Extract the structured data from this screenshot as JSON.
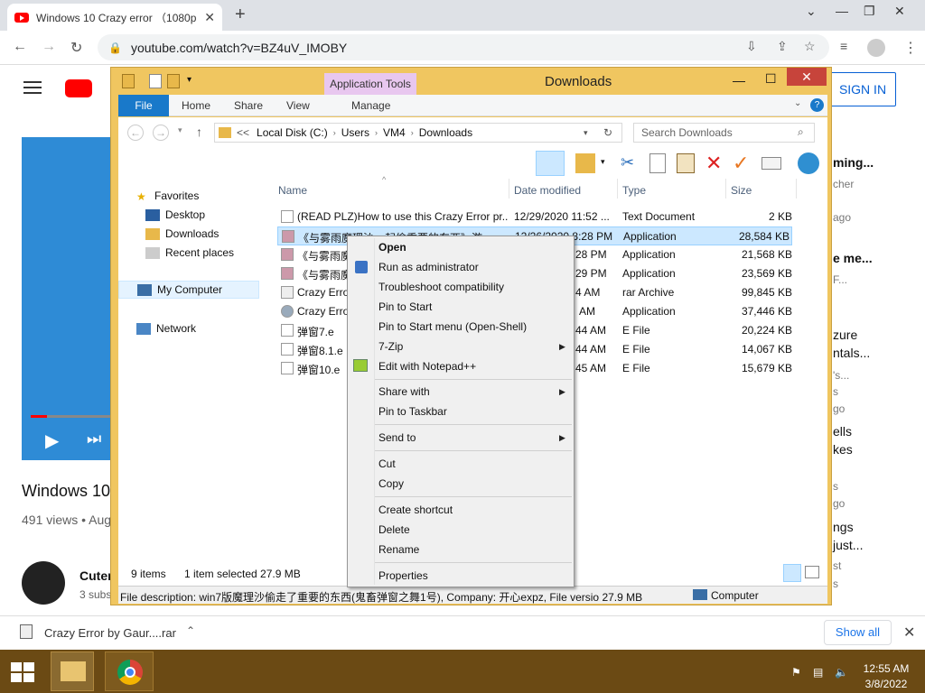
{
  "browser": {
    "tab_title": "Windows 10 Crazy error （1080p",
    "url": "youtube.com/watch?v=BZ4uV_IMOBY"
  },
  "youtube": {
    "video_title": "Windows 10",
    "views": "491 views • Aug",
    "channel": "Cuter",
    "subs": "3 subs",
    "sign_in": "SIGN IN",
    "side": [
      "ming...",
      "cher",
      "ago",
      "e me...",
      "F...",
      "zure",
      "ntals...",
      "'s...",
      "s",
      "go",
      "ells",
      "kes",
      "s",
      "go",
      "ngs",
      "just...",
      "st",
      "s"
    ]
  },
  "explorer": {
    "title": "Downloads",
    "app_tools": "Application Tools",
    "ribbon_tabs": [
      "File",
      "Home",
      "Share",
      "View",
      "Manage"
    ],
    "path": [
      "<<",
      "Local Disk (C:)",
      "Users",
      "VM4",
      "Downloads"
    ],
    "search_placeholder": "Search Downloads",
    "nav": {
      "favorites": "Favorites",
      "desktop": "Desktop",
      "downloads": "Downloads",
      "recent": "Recent places",
      "computer": "My Computer",
      "network": "Network"
    },
    "columns": {
      "name": "Name",
      "date": "Date modified",
      "type": "Type",
      "size": "Size"
    },
    "files": [
      {
        "name": "(READ PLZ)How to use this Crazy Error pr...",
        "date": "12/29/2020 11:52 ...",
        "type": "Text Document",
        "size": "2 KB"
      },
      {
        "name": "《与雾雨魔理沙一起偷重要的东西》游...",
        "date": "12/26/2020 8:28 PM",
        "type": "Application",
        "size": "28,584 KB"
      },
      {
        "name": "《与雾雨魔",
        "date": "28 PM",
        "type": "Application",
        "size": "21,568 KB"
      },
      {
        "name": "《与雾雨魔",
        "date": "29 PM",
        "type": "Application",
        "size": "23,569 KB"
      },
      {
        "name": "Crazy Error",
        "date": "4 AM",
        "type": "rar Archive",
        "size": "99,845 KB"
      },
      {
        "name": "Crazy Error",
        "date": "AM",
        "type": "Application",
        "size": "37,446 KB"
      },
      {
        "name": "弹窗7.e",
        "date": "44 AM",
        "type": "E File",
        "size": "20,224 KB"
      },
      {
        "name": "弹窗8.1.e",
        "date": "44 AM",
        "type": "E File",
        "size": "14,067 KB"
      },
      {
        "name": "弹窗10.e",
        "date": "45 AM",
        "type": "E File",
        "size": "15,679 KB"
      }
    ],
    "status_items": "9 items",
    "status_selected": "1 item selected  27.9 MB",
    "description": "File description: win7版魔理沙偷走了重要的东西(鬼畜弹窗之舞1号), Company: 开心expz, File versio 27.9 MB",
    "desc_computer": "Computer"
  },
  "context_menu": {
    "open": "Open",
    "run_admin": "Run as administrator",
    "troubleshoot": "Troubleshoot compatibility",
    "pin_start": "Pin to Start",
    "pin_start_menu": "Pin to Start menu (Open-Shell)",
    "zip": "7-Zip",
    "notepad": "Edit with Notepad++",
    "share_with": "Share with",
    "pin_taskbar": "Pin to Taskbar",
    "send_to": "Send to",
    "cut": "Cut",
    "copy": "Copy",
    "create_shortcut": "Create shortcut",
    "delete": "Delete",
    "rename": "Rename",
    "properties": "Properties"
  },
  "download_shelf": {
    "file": "Crazy Error by Gaur....rar",
    "show_all": "Show all"
  },
  "taskbar": {
    "time": "12:55 AM",
    "date": "3/8/2022"
  }
}
